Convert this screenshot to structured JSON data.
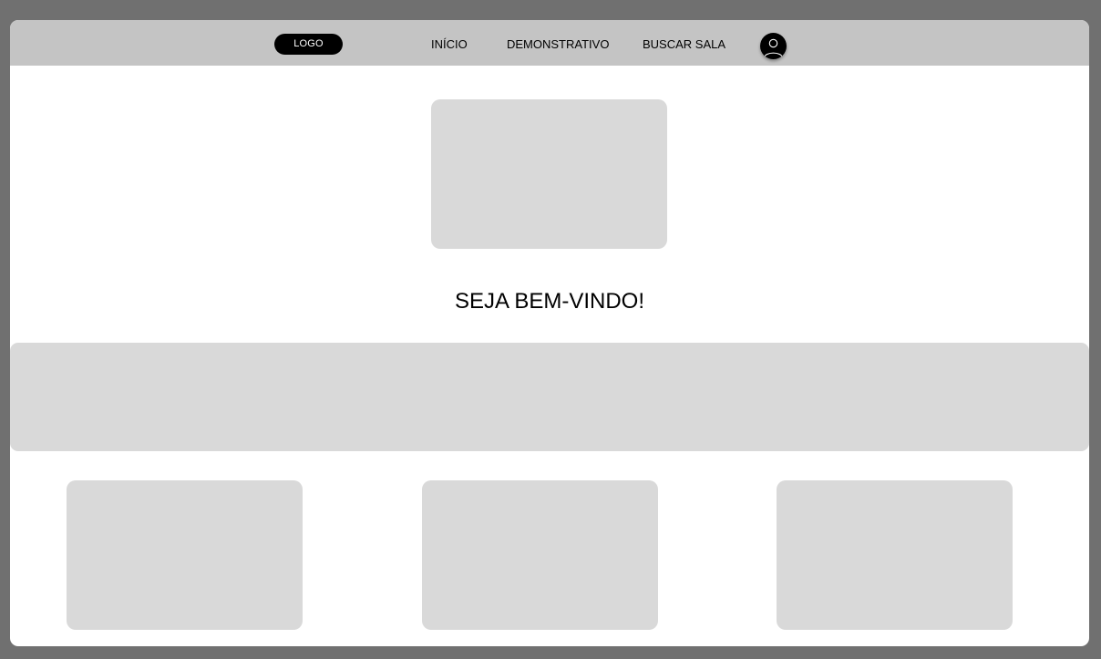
{
  "navbar": {
    "logo": "LOGO",
    "links": [
      {
        "label": "INÍCIO"
      },
      {
        "label": "DEMONSTRATIVO"
      },
      {
        "label": "BUSCAR SALA"
      }
    ],
    "profile_icon": "user-icon"
  },
  "main": {
    "welcome": "SEJA BEM-VINDO!"
  },
  "colors": {
    "page_background": "#707070",
    "frame_background": "#ffffff",
    "navbar_background": "#c4c4c4",
    "placeholder": "#d9d9d9",
    "logo_background": "#000000",
    "text": "#000000"
  }
}
